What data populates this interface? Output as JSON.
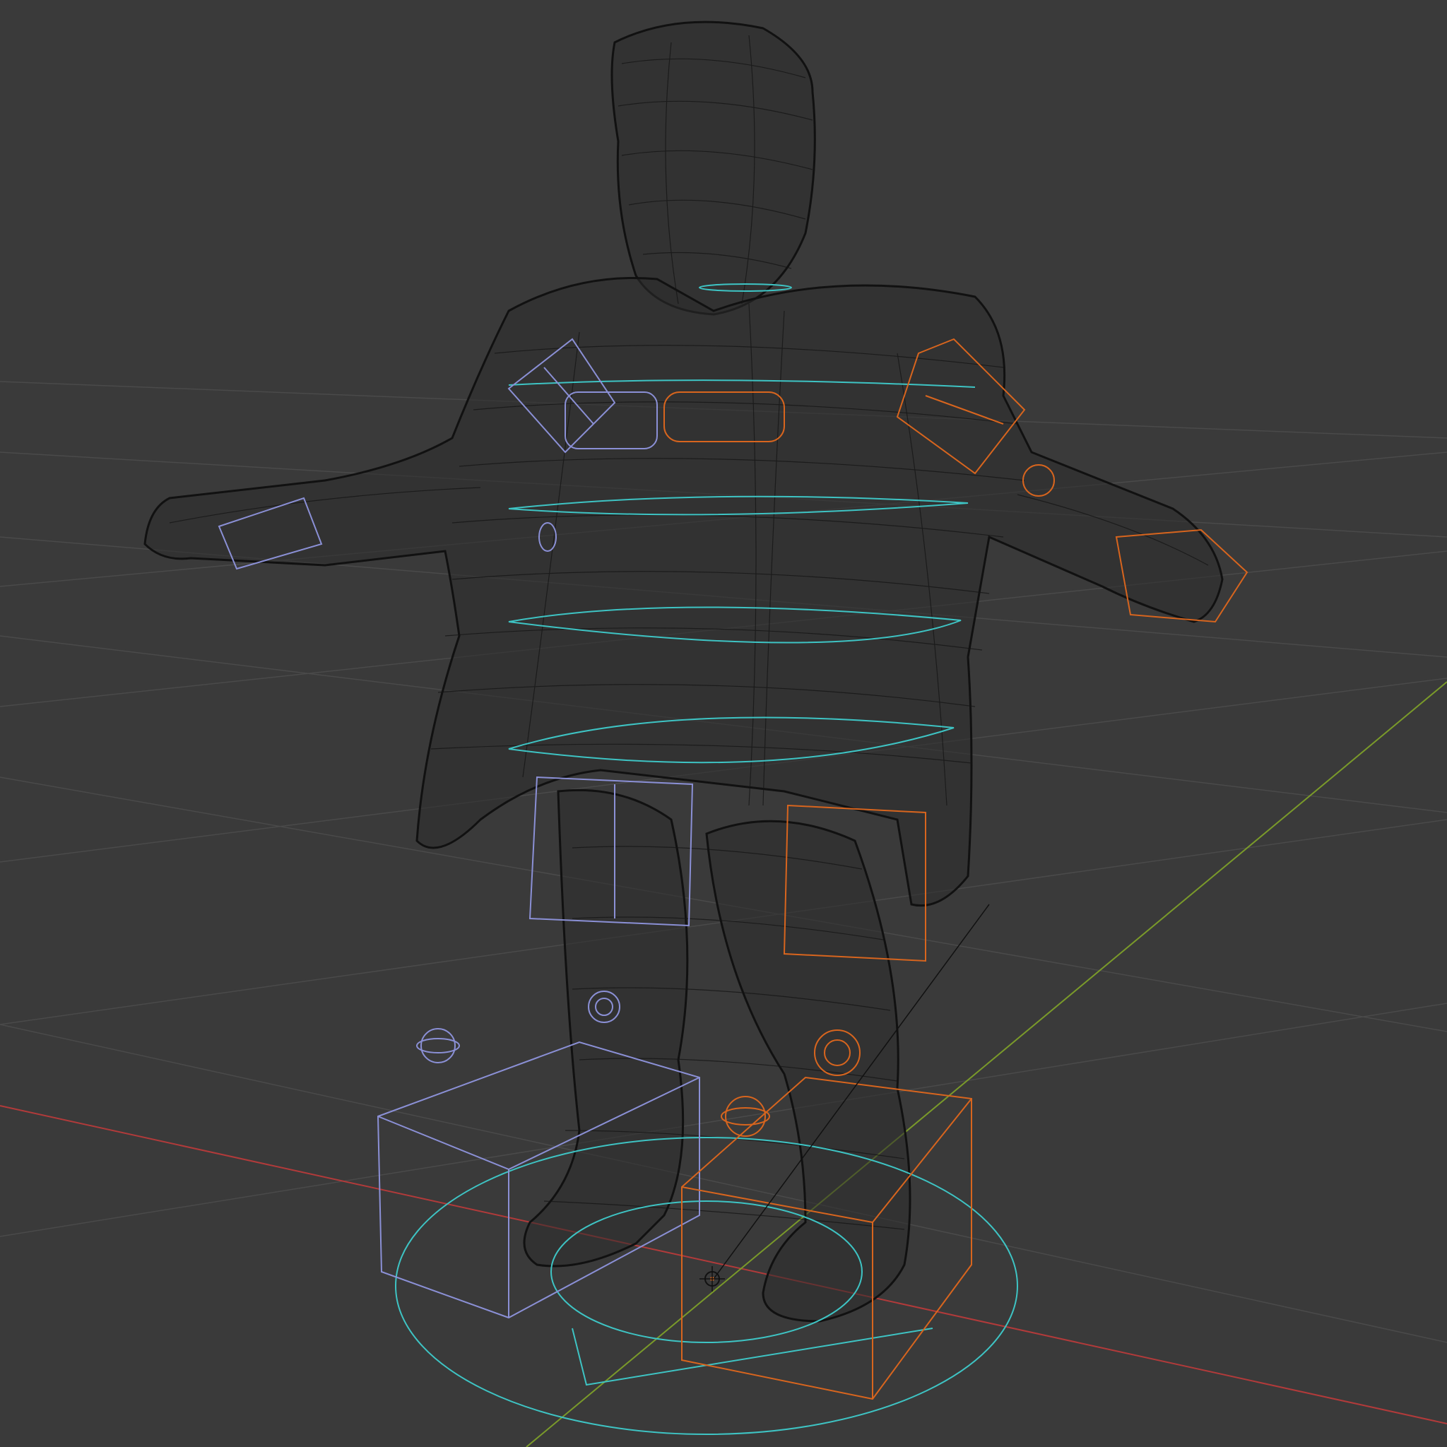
{
  "viewport": {
    "background": "#3a3a3a",
    "grid_color": "#4a4a4a",
    "axis_x_color": "#b23a3a",
    "axis_y_color": "#7a9a2a",
    "mesh_color": "#111111",
    "rig_left_color": "#8b90d6",
    "rig_right_color": "#d8651e",
    "rig_center_color": "#3ec4c4"
  },
  "objects": {
    "character_mesh": "wireframe-character-mesh",
    "armature_controls": "rig-control-shapes",
    "origin": "3d-cursor-icon"
  }
}
